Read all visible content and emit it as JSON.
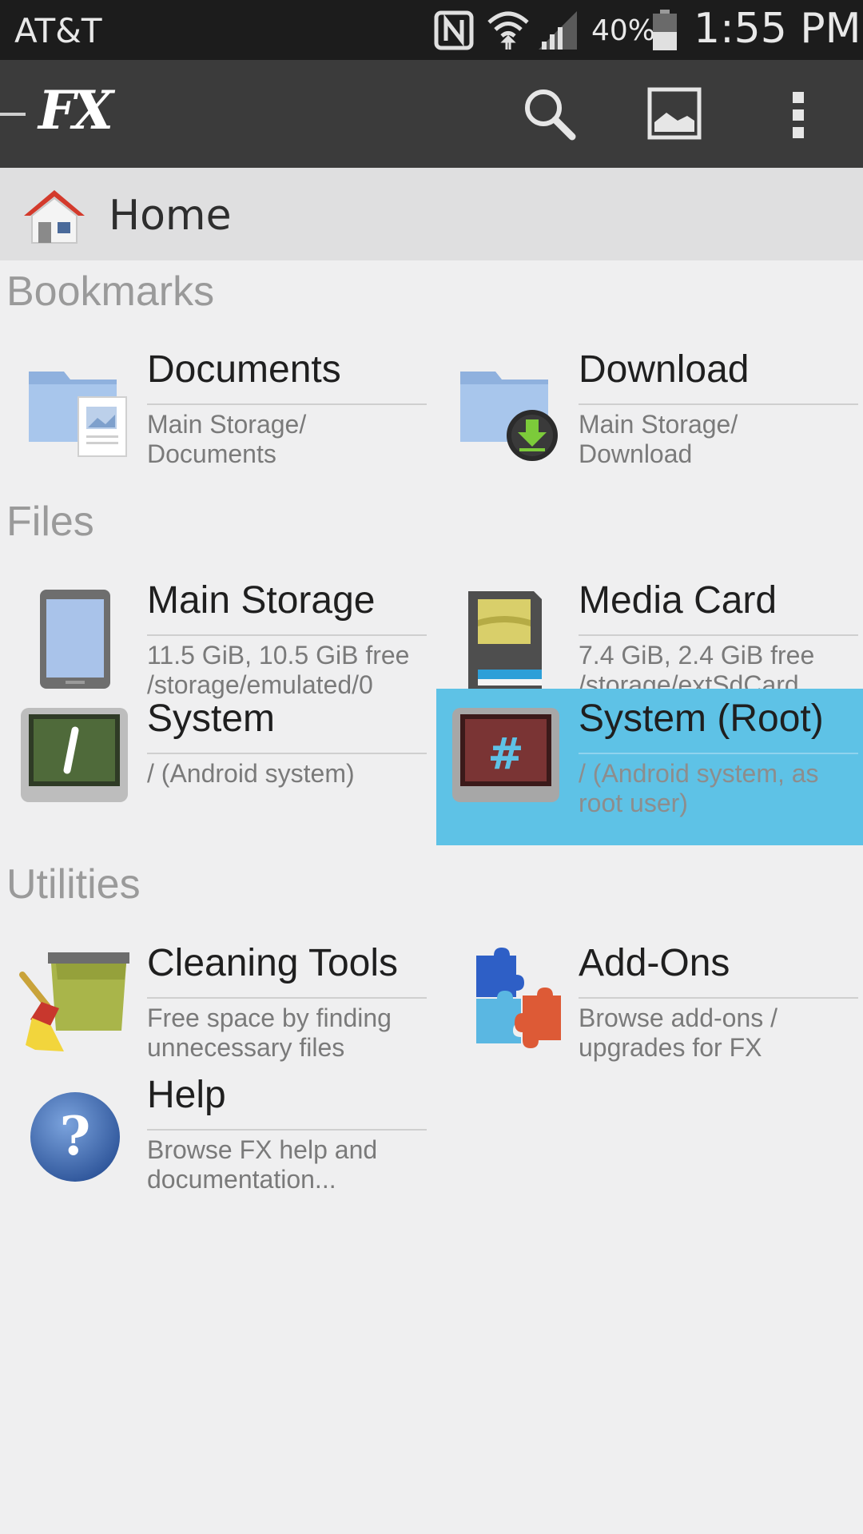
{
  "status_bar": {
    "carrier": "AT&T",
    "battery_percent": "40%",
    "time": "1:55 PM"
  },
  "action_bar": {
    "logo": "FX",
    "icons": [
      "search-icon",
      "image-icon",
      "overflow-menu-icon"
    ]
  },
  "breadcrumb": {
    "label": "Home"
  },
  "sections": {
    "bookmarks": "Bookmarks",
    "files": "Files",
    "utilities": "Utilities"
  },
  "bookmarks": [
    {
      "title": "Documents",
      "subtitle": "Main Storage/\nDocuments"
    },
    {
      "title": "Download",
      "subtitle": "Main Storage/\nDownload"
    }
  ],
  "files": [
    {
      "title": "Main Storage",
      "subtitle": "11.5 GiB, 10.5 GiB free\n/storage/emulated/0"
    },
    {
      "title": "Media Card",
      "subtitle": "7.4 GiB, 2.4 GiB free\n/storage/extSdCard"
    },
    {
      "title": "System",
      "subtitle": "/ (Android system)"
    },
    {
      "title": "System (Root)",
      "subtitle": "/ (Android system, as\nroot user)"
    }
  ],
  "utilities": [
    {
      "title": "Cleaning Tools",
      "subtitle": "Free space by finding\nunnecessary files"
    },
    {
      "title": "Add-Ons",
      "subtitle": "Browse add-ons /\nupgrades for FX"
    },
    {
      "title": "Help",
      "subtitle": "Browse FX help and\ndocumentation..."
    }
  ],
  "colors": {
    "highlight": "#5ec2e6",
    "action_bar": "#3b3b3b",
    "status_bar": "#1c1c1c"
  }
}
